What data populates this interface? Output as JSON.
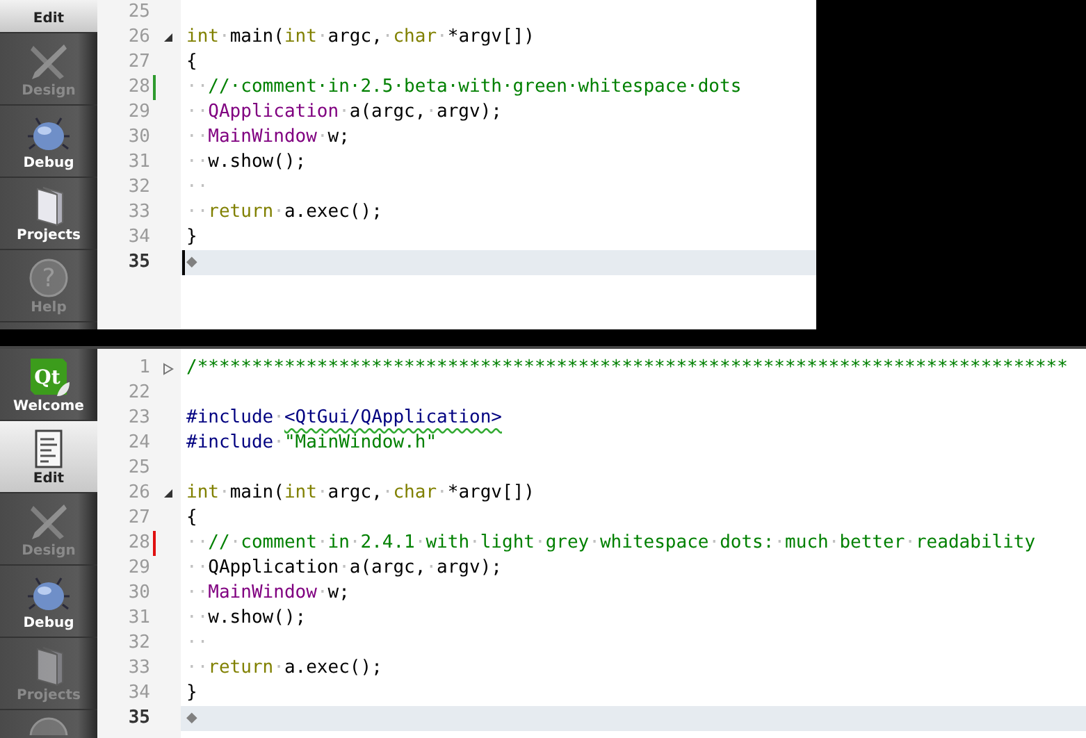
{
  "panels": [
    {
      "sidebar": [
        {
          "label": "Edit",
          "kind": "edit",
          "selected": true,
          "disabled": false,
          "clipped": true
        },
        {
          "label": "Design",
          "kind": "design",
          "selected": false,
          "disabled": true
        },
        {
          "label": "Debug",
          "kind": "debug",
          "selected": false,
          "disabled": false
        },
        {
          "label": "Projects",
          "kind": "projects",
          "selected": false,
          "disabled": false
        },
        {
          "label": "Help",
          "kind": "help",
          "icon_text": "?",
          "selected": false,
          "disabled": true
        }
      ],
      "lines": [
        {
          "number": "25"
        },
        {
          "number": "26",
          "foldable": true,
          "folded": false,
          "tokens": [
            {
              "text": "int",
              "kind": "keyword"
            },
            {
              "text": "·",
              "kind": "ws"
            },
            {
              "text": "main(",
              "kind": "plain"
            },
            {
              "text": "int",
              "kind": "keyword"
            },
            {
              "text": "·",
              "kind": "ws"
            },
            {
              "text": "argc,",
              "kind": "plain"
            },
            {
              "text": "·",
              "kind": "ws"
            },
            {
              "text": "char",
              "kind": "keyword"
            },
            {
              "text": "·",
              "kind": "ws"
            },
            {
              "text": "*argv[])",
              "kind": "plain"
            }
          ]
        },
        {
          "number": "27",
          "tokens": [
            {
              "text": "{",
              "kind": "plain"
            }
          ]
        },
        {
          "number": "28",
          "color": "#2e9a2e",
          "tokens": [
            {
              "text": "··",
              "kind": "ws"
            },
            {
              "text": "//·comment·in·2.5·beta·with·green·whitespace·dots",
              "kind": "comment"
            }
          ]
        },
        {
          "number": "29",
          "tokens": [
            {
              "text": "··",
              "kind": "ws"
            },
            {
              "text": "QApplication",
              "kind": "type"
            },
            {
              "text": "·",
              "kind": "ws"
            },
            {
              "text": "a(argc,",
              "kind": "plain"
            },
            {
              "text": "·",
              "kind": "ws"
            },
            {
              "text": "argv);",
              "kind": "plain"
            }
          ]
        },
        {
          "number": "30",
          "tokens": [
            {
              "text": "··",
              "kind": "ws"
            },
            {
              "text": "MainWindow",
              "kind": "type"
            },
            {
              "text": "·",
              "kind": "ws"
            },
            {
              "text": "w;",
              "kind": "plain"
            }
          ]
        },
        {
          "number": "31",
          "tokens": [
            {
              "text": "··",
              "kind": "ws"
            },
            {
              "text": "w.show();",
              "kind": "plain"
            }
          ]
        },
        {
          "number": "32",
          "tokens": [
            {
              "text": "··",
              "kind": "ws"
            }
          ]
        },
        {
          "number": "33",
          "tokens": [
            {
              "text": "··",
              "kind": "ws"
            },
            {
              "text": "return",
              "kind": "keyword"
            },
            {
              "text": "·",
              "kind": "ws"
            },
            {
              "text": "a.exec();",
              "kind": "plain"
            }
          ]
        },
        {
          "number": "34",
          "tokens": [
            {
              "text": "}",
              "kind": "plain"
            }
          ]
        },
        {
          "number": "35",
          "current": true,
          "cursor": true,
          "tokens": [
            {
              "text": "◆",
              "kind": "mark"
            }
          ]
        }
      ]
    },
    {
      "sidebar": [
        {
          "label": "Welcome",
          "kind": "qt",
          "icon_text": "Qt",
          "selected": false,
          "disabled": false
        },
        {
          "label": "Edit",
          "kind": "edit",
          "selected": true,
          "disabled": false
        },
        {
          "label": "Design",
          "kind": "design",
          "selected": false,
          "disabled": true
        },
        {
          "label": "Debug",
          "kind": "debug",
          "selected": false,
          "disabled": false
        },
        {
          "label": "Projects",
          "kind": "projects",
          "selected": false,
          "disabled": true
        },
        {
          "kind": "help",
          "selected": false,
          "disabled": true,
          "clipped": true
        }
      ],
      "lines": [
        {
          "number": "1",
          "foldable": true,
          "folded": true,
          "tokens": [
            {
              "text": "/********************************************************************************",
              "kind": "comment"
            }
          ]
        },
        {
          "number": "22"
        },
        {
          "number": "23",
          "tokens": [
            {
              "text": "#include",
              "kind": "preproc"
            },
            {
              "text": "·",
              "kind": "ws"
            },
            {
              "text": "<QtGui/QApplication>",
              "kind": "preproc",
              "squiggle": true
            }
          ]
        },
        {
          "number": "24",
          "tokens": [
            {
              "text": "#include",
              "kind": "preproc"
            },
            {
              "text": "·",
              "kind": "ws"
            },
            {
              "text": "\"MainWindow.h\"",
              "kind": "string"
            }
          ]
        },
        {
          "number": "25"
        },
        {
          "number": "26",
          "foldable": true,
          "folded": false,
          "tokens": [
            {
              "text": "int",
              "kind": "keyword"
            },
            {
              "text": "·",
              "kind": "ws"
            },
            {
              "text": "main(",
              "kind": "plain"
            },
            {
              "text": "int",
              "kind": "keyword"
            },
            {
              "text": "·",
              "kind": "ws"
            },
            {
              "text": "argc,",
              "kind": "plain"
            },
            {
              "text": "·",
              "kind": "ws"
            },
            {
              "text": "char",
              "kind": "keyword"
            },
            {
              "text": "·",
              "kind": "ws"
            },
            {
              "text": "*argv[])",
              "kind": "plain"
            }
          ]
        },
        {
          "number": "27",
          "tokens": [
            {
              "text": "{",
              "kind": "plain"
            }
          ]
        },
        {
          "number": "28",
          "color": "#e01010",
          "tokens": [
            {
              "text": "··",
              "kind": "ws"
            },
            {
              "text": "//",
              "kind": "comment"
            },
            {
              "text": "·",
              "kind": "ws"
            },
            {
              "text": "comment",
              "kind": "comment"
            },
            {
              "text": "·",
              "kind": "ws"
            },
            {
              "text": "in",
              "kind": "comment"
            },
            {
              "text": "·",
              "kind": "ws"
            },
            {
              "text": "2.4.1",
              "kind": "comment"
            },
            {
              "text": "·",
              "kind": "ws"
            },
            {
              "text": "with",
              "kind": "comment"
            },
            {
              "text": "·",
              "kind": "ws"
            },
            {
              "text": "light",
              "kind": "comment"
            },
            {
              "text": "·",
              "kind": "ws"
            },
            {
              "text": "grey",
              "kind": "comment"
            },
            {
              "text": "·",
              "kind": "ws"
            },
            {
              "text": "whitespace",
              "kind": "comment"
            },
            {
              "text": "·",
              "kind": "ws"
            },
            {
              "text": "dots:",
              "kind": "comment"
            },
            {
              "text": "·",
              "kind": "ws"
            },
            {
              "text": "much",
              "kind": "comment"
            },
            {
              "text": "·",
              "kind": "ws"
            },
            {
              "text": "better",
              "kind": "comment"
            },
            {
              "text": "·",
              "kind": "ws"
            },
            {
              "text": "readability",
              "kind": "comment"
            }
          ]
        },
        {
          "number": "29",
          "tokens": [
            {
              "text": "··",
              "kind": "ws"
            },
            {
              "text": "QApplication",
              "kind": "plain"
            },
            {
              "text": "·",
              "kind": "ws"
            },
            {
              "text": "a(argc,",
              "kind": "plain"
            },
            {
              "text": "·",
              "kind": "ws"
            },
            {
              "text": "argv);",
              "kind": "plain"
            }
          ]
        },
        {
          "number": "30",
          "tokens": [
            {
              "text": "··",
              "kind": "ws"
            },
            {
              "text": "MainWindow",
              "kind": "type"
            },
            {
              "text": "·",
              "kind": "ws"
            },
            {
              "text": "w;",
              "kind": "plain"
            }
          ]
        },
        {
          "number": "31",
          "tokens": [
            {
              "text": "··",
              "kind": "ws"
            },
            {
              "text": "w.show();",
              "kind": "plain"
            }
          ]
        },
        {
          "number": "32",
          "tokens": [
            {
              "text": "··",
              "kind": "ws"
            }
          ]
        },
        {
          "number": "33",
          "tokens": [
            {
              "text": "··",
              "kind": "ws"
            },
            {
              "text": "return",
              "kind": "keyword"
            },
            {
              "text": "·",
              "kind": "ws"
            },
            {
              "text": "a.exec();",
              "kind": "plain"
            }
          ]
        },
        {
          "number": "34",
          "tokens": [
            {
              "text": "}",
              "kind": "plain"
            }
          ]
        },
        {
          "number": "35",
          "current": true,
          "tokens": [
            {
              "text": "◆",
              "kind": "mark"
            }
          ]
        }
      ]
    }
  ]
}
